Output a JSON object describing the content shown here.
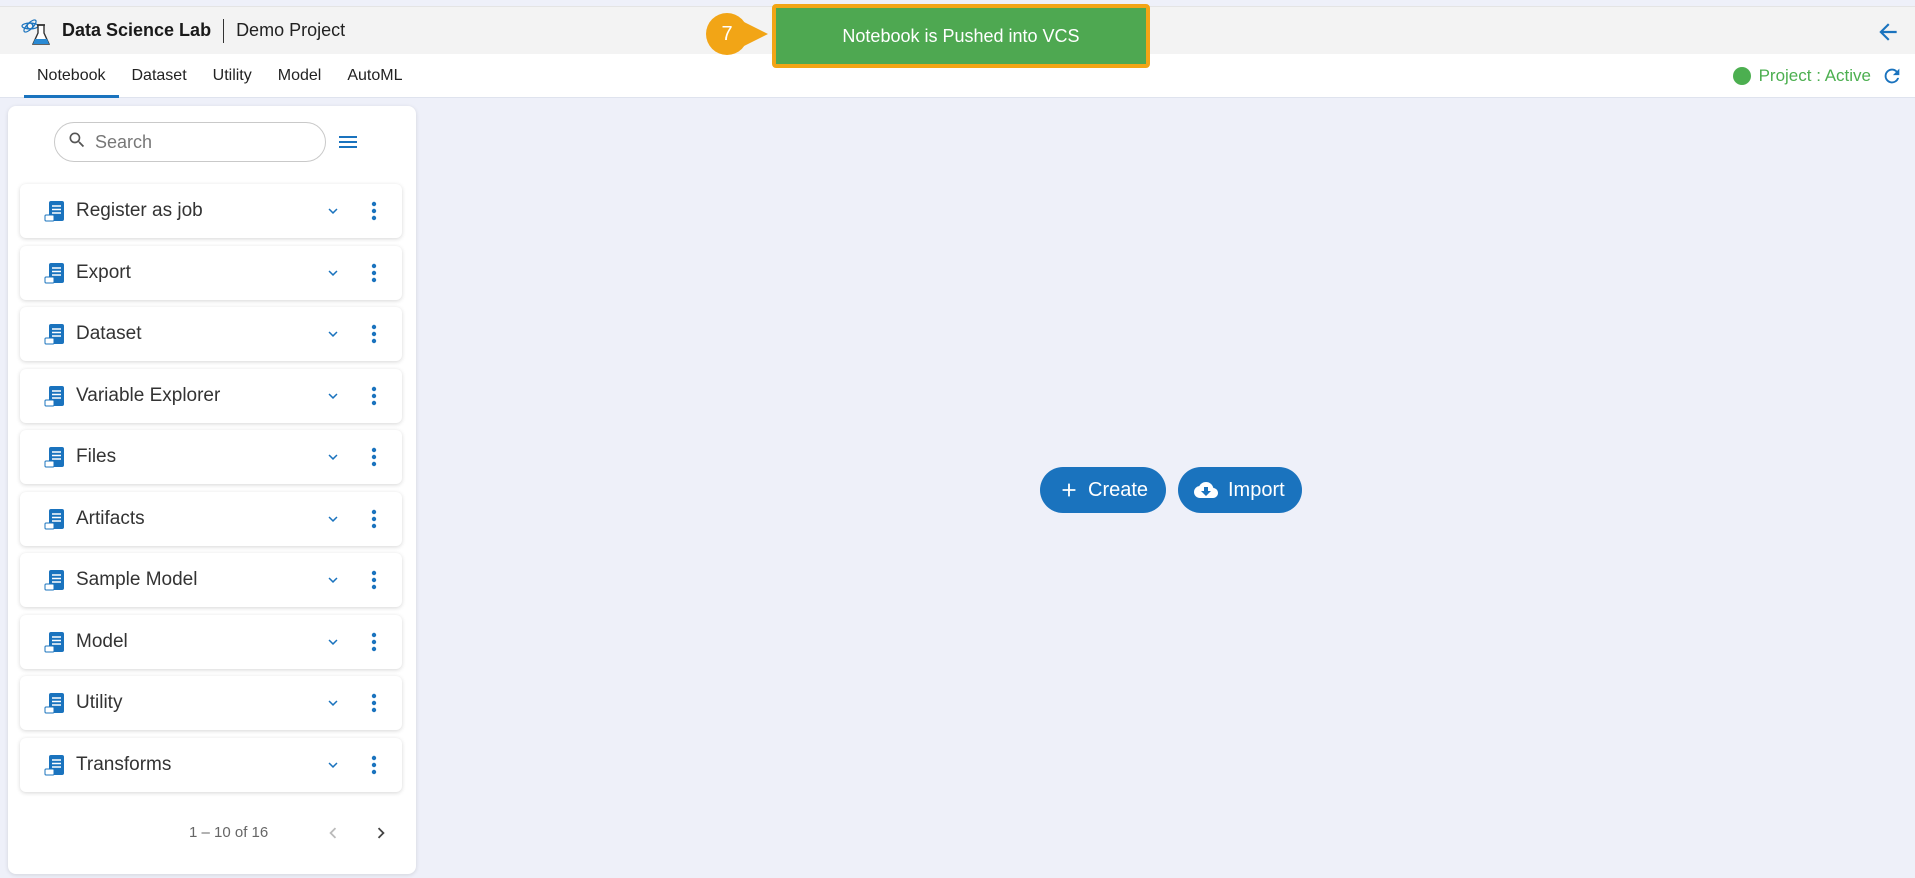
{
  "header": {
    "app_title": "Data Science Lab",
    "project_title": "Demo Project"
  },
  "tabs": [
    {
      "label": "Notebook",
      "active": true
    },
    {
      "label": "Dataset",
      "active": false
    },
    {
      "label": "Utility",
      "active": false
    },
    {
      "label": "Model",
      "active": false
    },
    {
      "label": "AutoML",
      "active": false
    }
  ],
  "project_status": "Project : Active",
  "search": {
    "placeholder": "Search"
  },
  "notebooks": [
    {
      "label": "Register as job"
    },
    {
      "label": "Export"
    },
    {
      "label": "Dataset"
    },
    {
      "label": "Variable Explorer"
    },
    {
      "label": "Files"
    },
    {
      "label": "Artifacts"
    },
    {
      "label": "Sample Model"
    },
    {
      "label": "Model"
    },
    {
      "label": "Utility"
    },
    {
      "label": "Transforms"
    }
  ],
  "pagination": {
    "range": "1 – 10 of 16"
  },
  "actions": {
    "create_label": "Create",
    "import_label": "Import"
  },
  "toast": {
    "message": "Notebook is Pushed into VCS",
    "step": "7"
  },
  "colors": {
    "primary": "#1a73be",
    "success": "#4caf50",
    "toast_bg": "#4ea851",
    "highlight": "#f2a516"
  }
}
